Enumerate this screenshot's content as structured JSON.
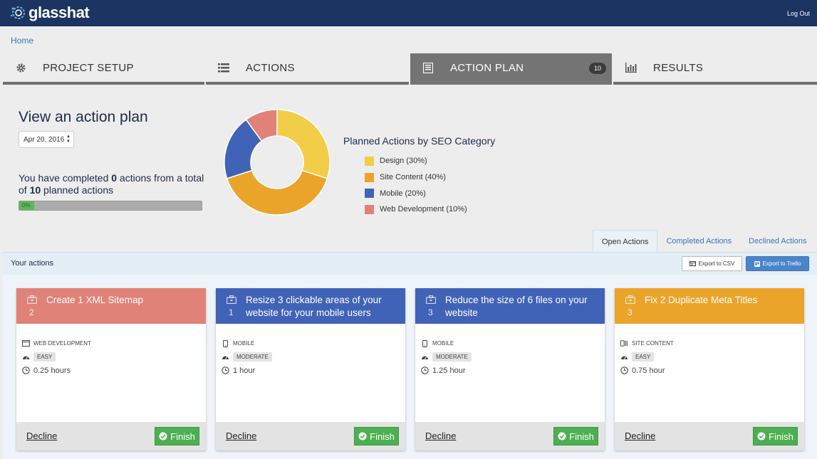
{
  "header": {
    "logo_text": "glasshat",
    "logout_label": "Log Out"
  },
  "breadcrumb": {
    "home": "Home"
  },
  "tabs": [
    {
      "label": "PROJECT SETUP",
      "icon": "gear-icon"
    },
    {
      "label": "ACTIONS",
      "icon": "list-icon"
    },
    {
      "label": "ACTION PLAN",
      "icon": "document-icon",
      "count": "10"
    },
    {
      "label": "RESULTS",
      "icon": "bar-chart-icon"
    }
  ],
  "plan": {
    "heading": "View an action plan",
    "date_value": "Apr 20, 2016",
    "completed_prefix": "You have completed ",
    "completed_count": "0",
    "completed_middle": " actions from a total of ",
    "total_count": "10",
    "completed_suffix": " planned actions",
    "progress_label": "0%",
    "progress_value": 0
  },
  "chart_data": {
    "type": "pie",
    "title": "Planned Actions by SEO Category",
    "series": [
      {
        "name": "Design (30%)",
        "value": 30,
        "color": "#f2cd47"
      },
      {
        "name": "Site Content (40%)",
        "value": 40,
        "color": "#eba42a"
      },
      {
        "name": "Mobile (20%)",
        "value": 20,
        "color": "#4163b7"
      },
      {
        "name": "Web Development (10%)",
        "value": 10,
        "color": "#e08277"
      }
    ]
  },
  "subtabs": {
    "open": "Open Actions",
    "completed": "Completed Actions",
    "declined": "Declined Actions"
  },
  "panel": {
    "title": "Your actions",
    "export_csv": "Export to CSV",
    "export_trello": "Export to Trello"
  },
  "cards": [
    {
      "title": "Create 1 XML Sitemap",
      "number": "2",
      "color": "#e08277",
      "category": "WEB DEVELOPMENT",
      "difficulty": "EASY",
      "time": "0.25 hours",
      "decline": "Decline",
      "finish": "Finish"
    },
    {
      "title": "Resize 3 clickable areas of your website for your mobile users",
      "number": "1",
      "color": "#4163b7",
      "category": "MOBILE",
      "difficulty": "MODERATE",
      "time": "1 hour",
      "decline": "Decline",
      "finish": "Finish"
    },
    {
      "title": "Reduce the size of 6 files on your website",
      "number": "3",
      "color": "#4163b7",
      "category": "MOBILE",
      "difficulty": "MODERATE",
      "time": "1.25 hour",
      "decline": "Decline",
      "finish": "Finish"
    },
    {
      "title": "Fix 2 Duplicate Meta Titles",
      "number": "3",
      "color": "#eba42a",
      "category": "SITE CONTENT",
      "difficulty": "EASY",
      "time": "0.75 hour",
      "decline": "Decline",
      "finish": "Finish"
    }
  ]
}
